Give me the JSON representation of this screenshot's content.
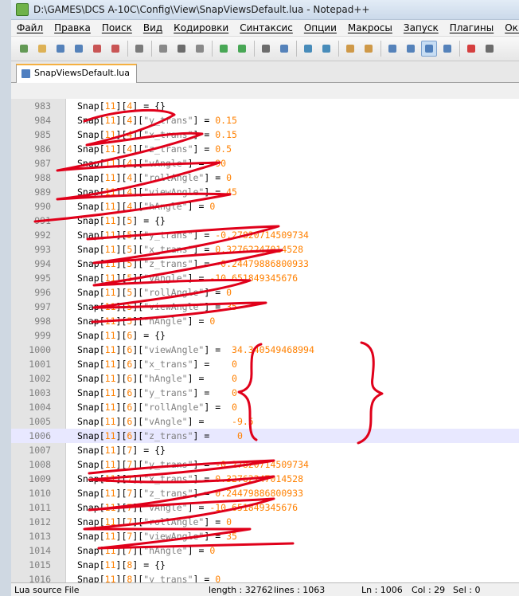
{
  "window": {
    "title": "D:\\GAMES\\DCS A-10C\\Config\\View\\SnapViewsDefault.lua - Notepad++"
  },
  "menu": [
    "Файл",
    "Правка",
    "Поиск",
    "Вид",
    "Кодировки",
    "Синтаксис",
    "Опции",
    "Макросы",
    "Запуск",
    "Плагины",
    "Окна",
    "?"
  ],
  "toolbar_icons": [
    "new-file-icon",
    "open-file-icon",
    "save-icon",
    "save-all-icon",
    "close-icon",
    "close-all-icon",
    "print-icon",
    "cut-icon",
    "copy-icon",
    "paste-icon",
    "undo-icon",
    "redo-icon",
    "find-icon",
    "replace-icon",
    "zoom-in-icon",
    "zoom-out-icon",
    "sync-v-icon",
    "sync-h-icon",
    "word-wrap-icon",
    "show-all-chars-icon",
    "indent-guide-icon",
    "doc-map-icon",
    "record-macro-icon",
    "stop-macro-icon"
  ],
  "tab": {
    "label": "SnapViewsDefault.lua"
  },
  "lines": [
    {
      "n": "983",
      "t": "Snap[11][4] = {}"
    },
    {
      "n": "984",
      "t": "Snap[11][4][\"y_trans\"] = 0.15"
    },
    {
      "n": "985",
      "t": "Snap[11][4][\"x_trans\"] = 0.15"
    },
    {
      "n": "986",
      "t": "Snap[11][4][\"z_trans\"] = 0.5"
    },
    {
      "n": "987",
      "t": "Snap[11][4][\"vAngle\"] = -90"
    },
    {
      "n": "988",
      "t": "Snap[11][4][\"rollAngle\"] = 0"
    },
    {
      "n": "989",
      "t": "Snap[11][4][\"viewAngle\"] = 45"
    },
    {
      "n": "990",
      "t": "Snap[11][4][\"hAngle\"] = 0"
    },
    {
      "n": "991",
      "t": "Snap[11][5] = {}"
    },
    {
      "n": "992",
      "t": "Snap[11][5][\"y_trans\"] = -0.27820714509734"
    },
    {
      "n": "993",
      "t": "Snap[11][5][\"x_trans\"] = 0.32762247014528"
    },
    {
      "n": "994",
      "t": "Snap[11][5][\"z_trans\"] = -0.24479886800933"
    },
    {
      "n": "995",
      "t": "Snap[11][5][\"vAngle\"] = -10.651849345676"
    },
    {
      "n": "996",
      "t": "Snap[11][5][\"rollAngle\"] = 0"
    },
    {
      "n": "997",
      "t": "Snap[11][5][\"viewAngle\"] = 35"
    },
    {
      "n": "998",
      "t": "Snap[11][5][\"hAngle\"] = 0"
    },
    {
      "n": "999",
      "t": "Snap[11][6] = {}"
    },
    {
      "n": "1000",
      "t": "Snap[11][6][\"viewAngle\"] =  34.340549468994"
    },
    {
      "n": "1001",
      "t": "Snap[11][6][\"x_trans\"] =    0"
    },
    {
      "n": "1002",
      "t": "Snap[11][6][\"hAngle\"] =     0"
    },
    {
      "n": "1003",
      "t": "Snap[11][6][\"y_trans\"] =    0"
    },
    {
      "n": "1004",
      "t": "Snap[11][6][\"rollAngle\"] =  0"
    },
    {
      "n": "1005",
      "t": "Snap[11][6][\"vAngle\"] =     -9.5"
    },
    {
      "n": "1006",
      "t": "Snap[11][6][\"z_trans\"] =     0"
    },
    {
      "n": "1007",
      "t": "Snap[11][7] = {}"
    },
    {
      "n": "1008",
      "t": "Snap[11][7][\"y_trans\"] = -0.27820714509734"
    },
    {
      "n": "1009",
      "t": "Snap[11][7][\"x_trans\"] = 0.32762247014528"
    },
    {
      "n": "1010",
      "t": "Snap[11][7][\"z_trans\"] = 0.24479886800933"
    },
    {
      "n": "1011",
      "t": "Snap[11][7][\"vAngle\"] = -10.651849345676"
    },
    {
      "n": "1012",
      "t": "Snap[11][7][\"rollAngle\"] = 0"
    },
    {
      "n": "1013",
      "t": "Snap[11][7][\"viewAngle\"] = 35"
    },
    {
      "n": "1014",
      "t": "Snap[11][7][\"hAngle\"] = 0"
    },
    {
      "n": "1015",
      "t": "Snap[11][8] = {}"
    },
    {
      "n": "1016",
      "t": "Snap[11][8][\"y_trans\"] = 0"
    }
  ],
  "current_line": "1006",
  "status": {
    "file_type": "Lua source File",
    "length": "length : 32762",
    "lines": "lines : 1063",
    "ln": "Ln : 1006",
    "col": "Col : 29",
    "sel": "Sel : 0"
  },
  "colors": {
    "number": "#ff8000",
    "annotation": "#e0001a",
    "current_line": "#e8e8ff"
  }
}
